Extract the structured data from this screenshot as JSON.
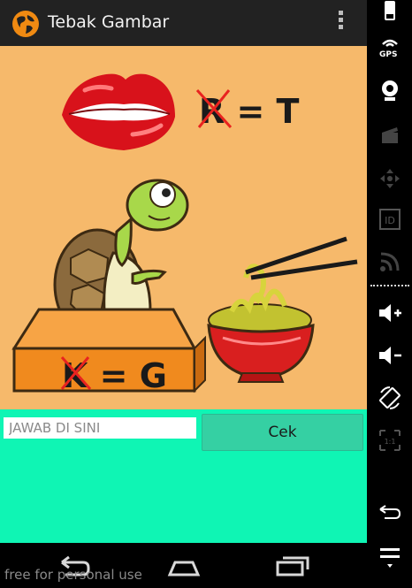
{
  "app": {
    "title": "Tebak Gambar",
    "icon": "globe-icon",
    "menu_icon": "overflow-menu-icon"
  },
  "quiz": {
    "clue_top": "R = T",
    "clue_box": "K = G",
    "image_elements": [
      "lips",
      "turtle",
      "noodle-bowl",
      "chopsticks"
    ]
  },
  "answer": {
    "placeholder": "JAWAB DI SINI",
    "value": ""
  },
  "check_button": {
    "label": "Cek"
  },
  "navbar": {
    "buttons": [
      "back-icon",
      "home-icon",
      "recent-apps-icon"
    ]
  },
  "watermark": "free for personal use",
  "sidebar": {
    "items": [
      "phone-icon",
      "gps-icon",
      "webcam-icon",
      "clapper-icon",
      "dpad-icon",
      "id-icon",
      "rss-icon",
      "volume-up-icon",
      "volume-down-icon",
      "rotate-icon",
      "scale-icon",
      "back-icon",
      "menu-icon"
    ],
    "gps_label": "GPS",
    "id_label": "ID"
  },
  "colors": {
    "action_bar": "#222222",
    "quiz_background": "#f6b96b",
    "answer_background": "#0ff5b4",
    "button": "#35d0a3"
  }
}
